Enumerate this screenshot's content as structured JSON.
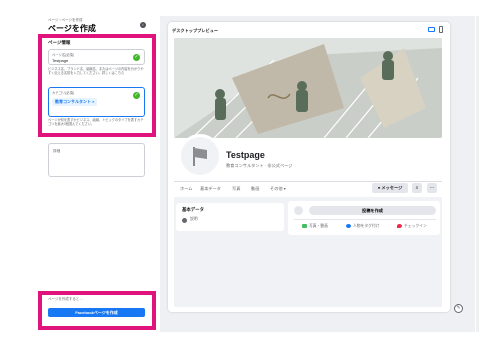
{
  "left": {
    "breadcrumb": "ページ › ページを作成",
    "title": "ページを作成",
    "section_title": "ページ情報",
    "name_field": {
      "label": "ページ名(必須)",
      "value": "Testpage"
    },
    "help1": "ビジネス名、ブランド名、組織名、またはページの内容を分かりやすく伝える名前を入力してください。詳しくはこちら",
    "category_field": {
      "label": "カテゴリ(必須)",
      "chip": "教育コンサルタント ×"
    },
    "help2": "ページが何を表すかビジネス、組織、トピックのタイプを表すカテゴリを最大3個選んでください。",
    "detail_label": "詳細",
    "footer_text": "ページを作成すると…",
    "create_button": "Facebookページを作成"
  },
  "preview": {
    "title": "デスクトッププレビュー",
    "page_name": "Testpage",
    "page_category": "教育コンサルタント · 非公式ページ",
    "tabs": [
      "ホーム",
      "基本データ",
      "写真",
      "動画",
      "その他 ▾"
    ],
    "message_button": "メッセージ",
    "search_icon": "⌕",
    "more_icon": "···",
    "intro_title": "基本データ",
    "intro_text": "説明",
    "post_button": "投稿を作成",
    "post_actions": [
      "写真・動画",
      "人物をタグ付け",
      "チェックイン"
    ],
    "colors": {
      "accent": "#1877f2",
      "highlight": "#e0127c",
      "check": "#42b72a"
    }
  }
}
